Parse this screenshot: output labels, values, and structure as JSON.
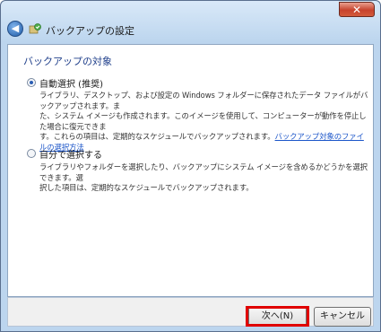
{
  "window": {
    "title": "バックアップの設定",
    "close_label": "✕",
    "back_label": "◀"
  },
  "main": {
    "heading": "バックアップの対象",
    "options": [
      {
        "label": "自動選択 (推奨)",
        "selected": true,
        "description_lines": [
          "ライブラリ、デスクトップ、および設定の Windows フォルダーに保存されたデータ ファイルがバックアップされます。ま",
          "た、システム イメージも作成されます。このイメージを使用して、コンピューターが動作を停止した場合に復元できま",
          "す。これらの項目は、定期的なスケジュールでバックアップされます。"
        ],
        "link": "バックアップ対象のファイルの選択方法"
      },
      {
        "label": "自分で選択する",
        "selected": false,
        "description_lines": [
          "ライブラリやフォルダーを選択したり、バックアップにシステム イメージを含めるかどうかを選択できます。選",
          "択した項目は、定期的なスケジュールでバックアップされます。"
        ]
      }
    ]
  },
  "footer": {
    "next_label": "次へ(N)",
    "cancel_label": "キャンセル"
  },
  "colors": {
    "heading": "#1e3e8a",
    "link": "#1c56c9",
    "highlight": "#e00000",
    "frame": "#bcd5ee"
  },
  "icons": [
    "close-icon",
    "back-arrow-icon",
    "backup-icon"
  ]
}
